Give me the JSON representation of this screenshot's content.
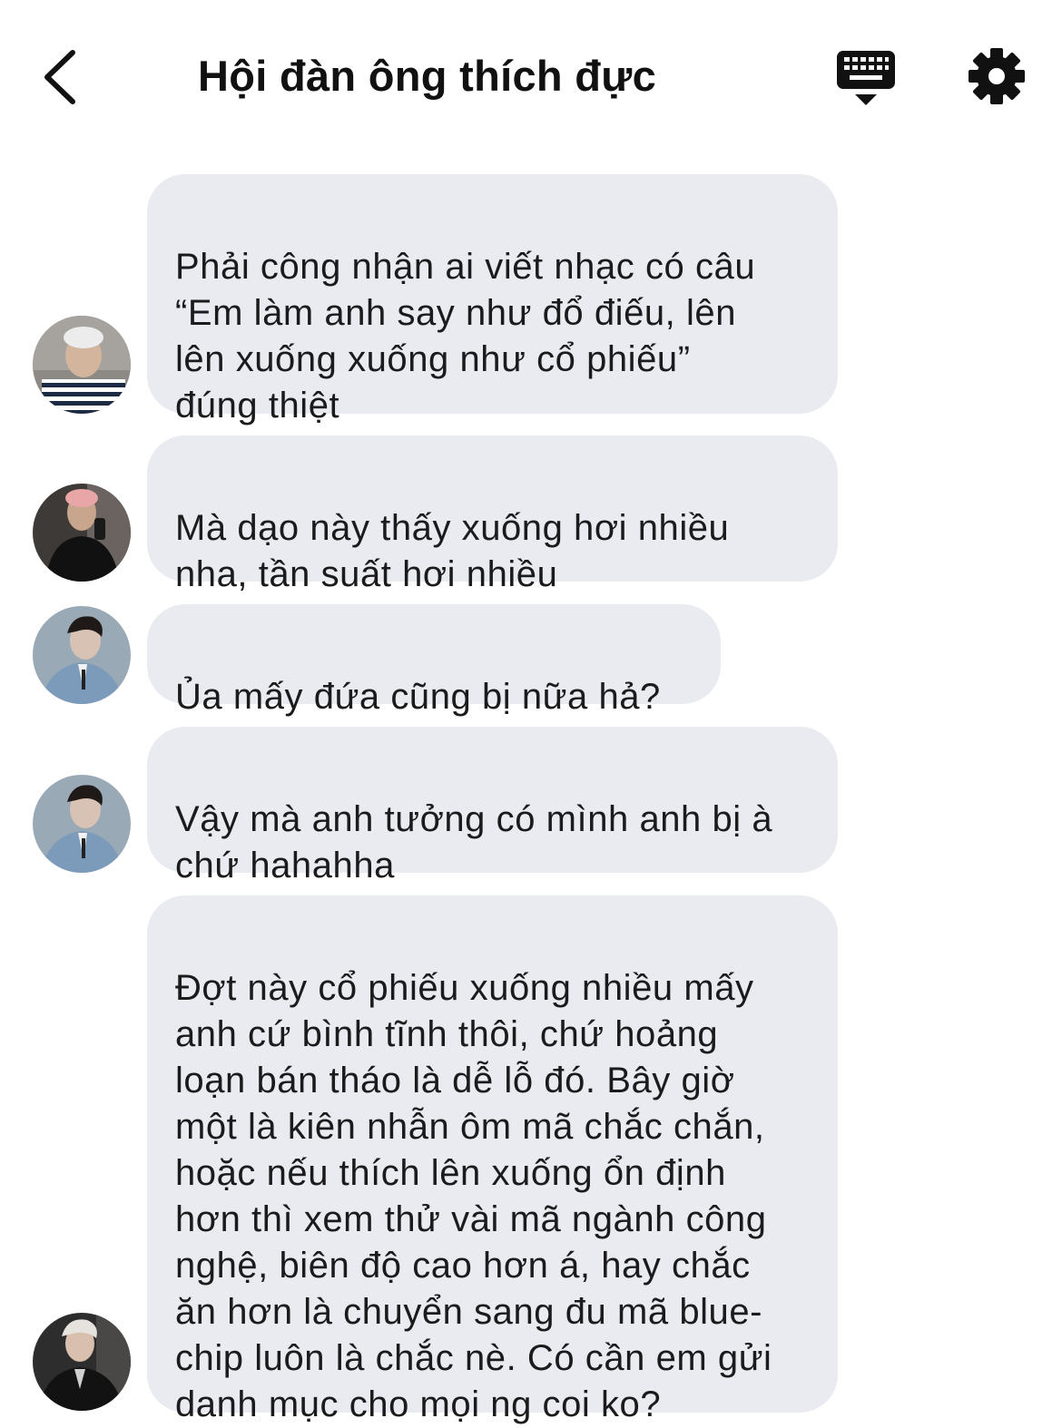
{
  "header": {
    "title": "Hội đàn ông thích đực",
    "back_icon": "chevron-left-icon",
    "keyboard_icon": "keyboard-icon",
    "settings_icon": "gear-icon"
  },
  "messages": [
    {
      "text": "Phải công nhận ai viết nhạc có câu\n“Em làm anh say như đổ điếu, lên\nlên xuống xuống như cổ phiếu”\nđúng thiệt"
    },
    {
      "text": "Mà dạo này thấy xuống hơi nhiều\nnha, tần suất hơi nhiều"
    },
    {
      "text": "Ủa mấy đứa cũng bị nữa hả?"
    },
    {
      "text": "Vậy mà anh tưởng có mình anh bị à\nchứ hahahha"
    },
    {
      "text": "Đợt này cổ phiếu xuống nhiều mấy\nanh cứ bình tĩnh thôi, chứ hoảng\nloạn bán tháo là dễ lỗ đó. Bây giờ\nmột là kiên nhẫn ôm mã chắc chắn,\nhoặc nếu thích lên xuống ổn định\nhơn thì xem thử vài mã ngành công\nnghệ, biên độ cao hơn á, hay chắc\năn hơn là chuyển sang đu mã blue-\nchip luôn là chắc nè. Có cần em gửi\ndanh mục cho mọi ng coi ko?"
    }
  ],
  "colors": {
    "bubble": "#e9ebf1",
    "text": "#1b1b1d",
    "background": "#ffffff"
  }
}
